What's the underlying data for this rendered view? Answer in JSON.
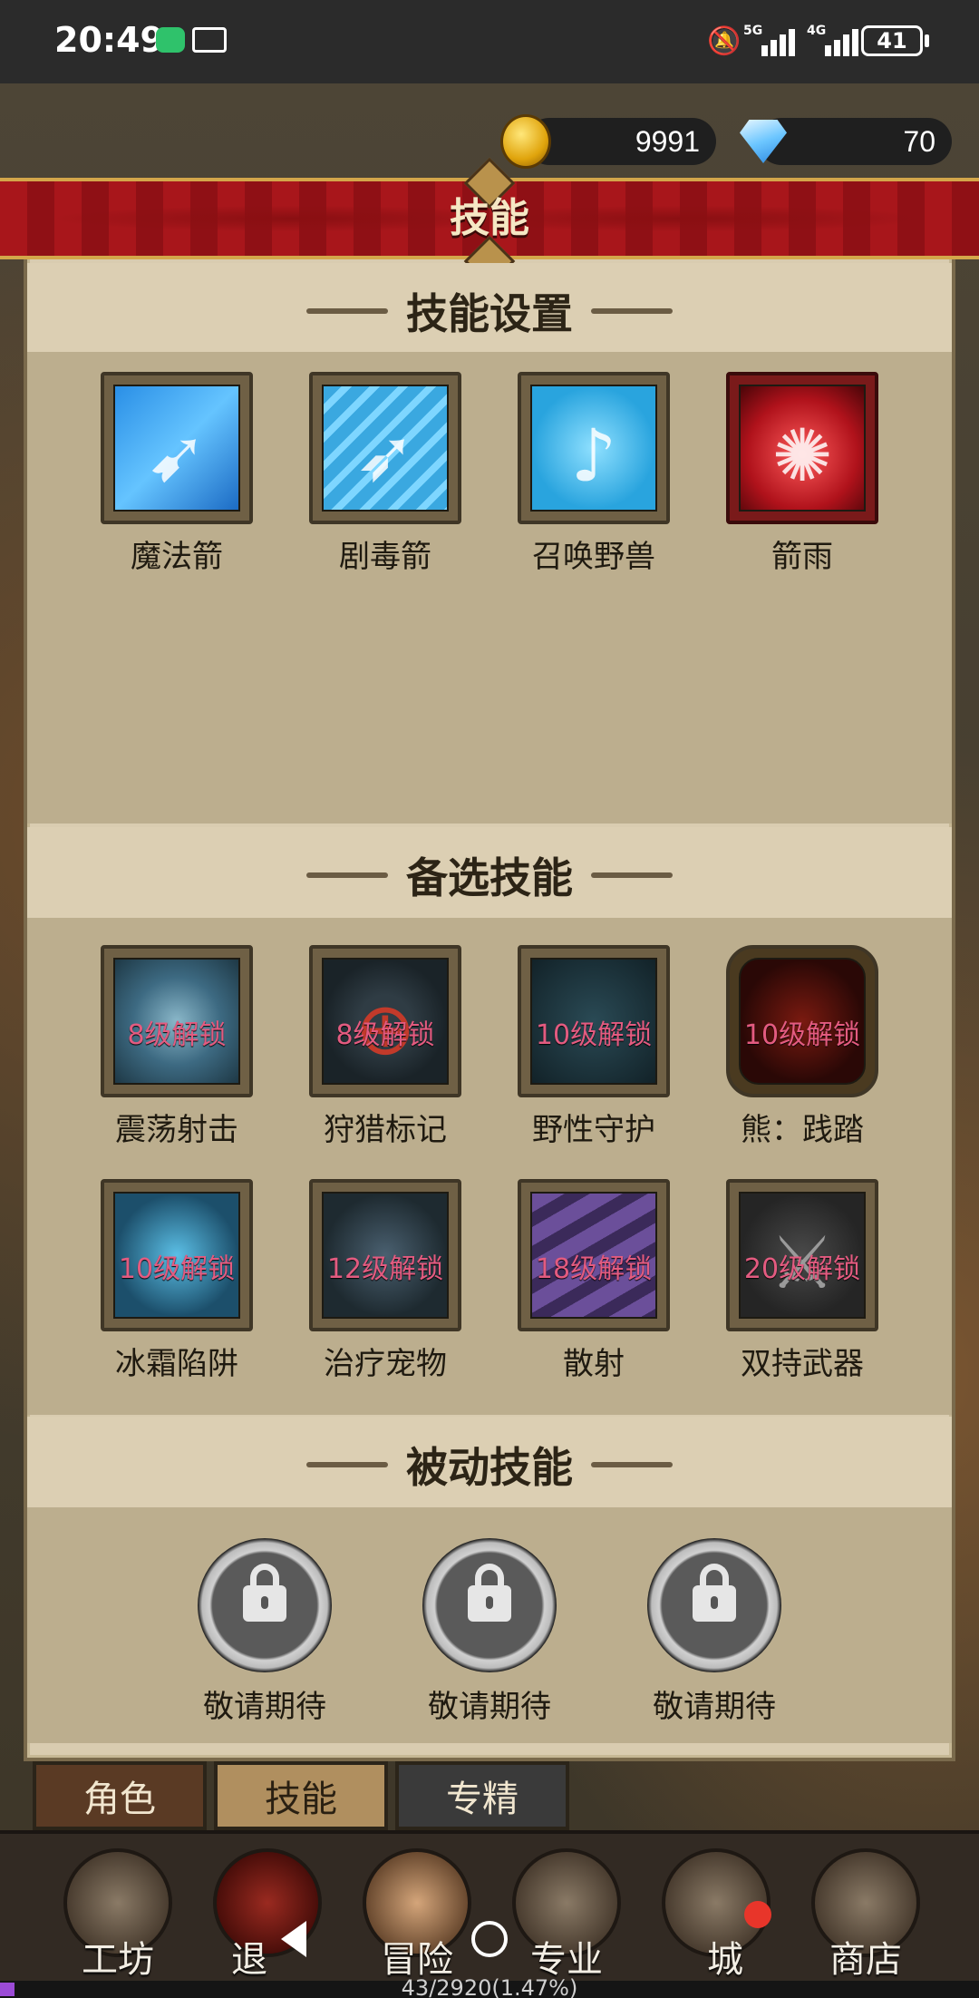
{
  "status_bar": {
    "time": "20:49",
    "battery": "41",
    "signal_1": "5G",
    "signal_2": "4G"
  },
  "currency": {
    "gold": "9991",
    "gems": "70"
  },
  "title": "技能",
  "sections": {
    "active": "技能设置",
    "candidate": "备选技能",
    "passive": "被动技能"
  },
  "active_skills": [
    {
      "name": "魔法箭"
    },
    {
      "name": "剧毒箭"
    },
    {
      "name": "召唤野兽"
    },
    {
      "name": "箭雨"
    }
  ],
  "candidate_skills": [
    {
      "name": "震荡射击",
      "lock": "8级解锁"
    },
    {
      "name": "狩猎标记",
      "lock": "8级解锁"
    },
    {
      "name": "野性守护",
      "lock": "10级解锁"
    },
    {
      "name": "熊：践踏",
      "lock": "10级解锁"
    },
    {
      "name": "冰霜陷阱",
      "lock": "10级解锁"
    },
    {
      "name": "治疗宠物",
      "lock": "12级解锁"
    },
    {
      "name": "散射",
      "lock": "18级解锁"
    },
    {
      "name": "双持武器",
      "lock": "20级解锁"
    }
  ],
  "passive_skills": [
    {
      "name": "敬请期待"
    },
    {
      "name": "敬请期待"
    },
    {
      "name": "敬请期待"
    }
  ],
  "tabs": {
    "role": "角色",
    "skill": "技能",
    "spec": "专精"
  },
  "nav": {
    "workshop": "工坊",
    "retreat": "退",
    "adventure": "冒险",
    "profession": "专业",
    "city": "城",
    "shop": "商店"
  },
  "xp": {
    "text": "43/2920(1.47%)",
    "progress": 0.0147
  }
}
